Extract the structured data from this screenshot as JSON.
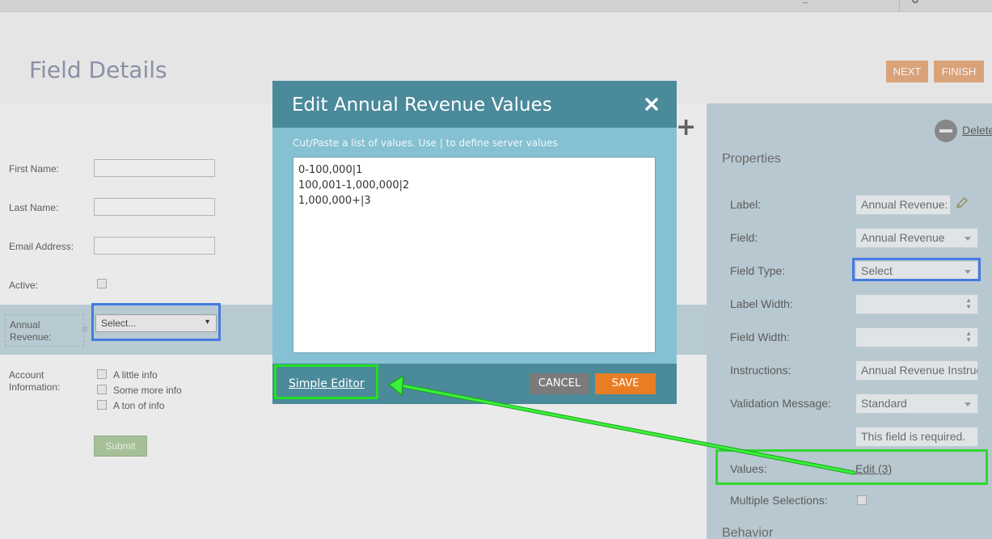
{
  "header": {
    "title": "Field Details",
    "next_label": "NEXT",
    "finish_label": "FINISH"
  },
  "form": {
    "first_name_label": "First Name:",
    "last_name_label": "Last Name:",
    "email_label": "Email Address:",
    "active_label": "Active:",
    "annual_revenue_label_line1": "Annual",
    "annual_revenue_label_line2": "Revenue:",
    "annual_revenue_select_value": "Select...",
    "account_info_label_line1": "Account",
    "account_info_label_line2": "Information:",
    "options": [
      "A little info",
      "Some more info",
      "A ton of info"
    ],
    "submit_label": "Submit"
  },
  "properties": {
    "title": "Properties",
    "delete_label": "Delete",
    "rows": [
      {
        "label": "Label:",
        "value": "Annual Revenue:"
      },
      {
        "label": "Field:",
        "value": "Annual Revenue"
      },
      {
        "label": "Field Type:",
        "value": "Select"
      },
      {
        "label": "Label Width:",
        "value": ""
      },
      {
        "label": "Field Width:",
        "value": ""
      },
      {
        "label": "Instructions:",
        "value": "Annual Revenue Instructions"
      },
      {
        "label": "Validation Message:",
        "value": "Standard"
      }
    ],
    "validation_text": "This field is required.",
    "values_label": "Values:",
    "values_edit_link": "Edit (3)",
    "multiple_selections_label": "Multiple Selections:",
    "behavior_title": "Behavior"
  },
  "modal": {
    "title": "Edit Annual Revenue Values",
    "hint": "Cut/Paste a list of values. Use | to define server values",
    "values": [
      "0-100,000|1",
      "100,001-1,000,000|2",
      "1,000,000+|3"
    ],
    "simple_editor_label": "Simple Editor",
    "cancel_label": "CANCEL",
    "save_label": "SAVE"
  },
  "colors": {
    "modal_header": "#4a8a9a",
    "modal_body": "#85c1d2",
    "save_button": "#e97d24",
    "annotation_green": "#23e023",
    "annotation_blue": "#3d78e8"
  }
}
